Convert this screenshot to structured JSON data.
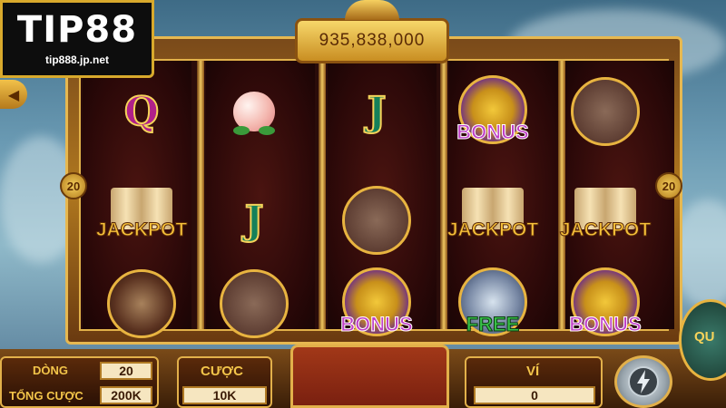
{
  "logo": {
    "brand": "TIP88",
    "url": "tip888.jp.net"
  },
  "balance": "935,838,000",
  "lines_left": "20",
  "lines_right": "20",
  "reels": [
    [
      {
        "type": "letter",
        "text": "Q",
        "kind": "q"
      },
      {
        "type": "jackpot",
        "text": "JACKPOT"
      },
      {
        "type": "icon",
        "icon": "warrior-icon"
      }
    ],
    [
      {
        "type": "icon",
        "icon": "peach-icon"
      },
      {
        "type": "letter",
        "text": "J",
        "kind": "j"
      },
      {
        "type": "icon",
        "icon": "pig-monk-icon"
      }
    ],
    [
      {
        "type": "letter",
        "text": "J",
        "kind": "j"
      },
      {
        "type": "icon",
        "icon": "pig-monk-icon"
      },
      {
        "type": "bonus",
        "text": "BONUS"
      }
    ],
    [
      {
        "type": "bonus",
        "text": "BONUS"
      },
      {
        "type": "jackpot",
        "text": "JACKPOT"
      },
      {
        "type": "free",
        "text": "FREE"
      }
    ],
    [
      {
        "type": "icon",
        "icon": "pig-monk-icon"
      },
      {
        "type": "jackpot",
        "text": "JACKPOT"
      },
      {
        "type": "bonus",
        "text": "BONUS"
      }
    ]
  ],
  "controls": {
    "dong_label": "DÒNG",
    "dong_value": "20",
    "tong_cuoc_label": "TỔNG CƯỢC",
    "tong_cuoc_value": "200K",
    "cuoc_label": "CƯỢC",
    "cuoc_value": "10K",
    "vi_label": "VÍ",
    "vi_value": "0",
    "qc_label": "QU"
  },
  "colors": {
    "gold": "#e2b04a",
    "frame_dark": "#2a0c0a",
    "jackpot": "#f6c13a",
    "bonus": "#c040c8",
    "free": "#38c048"
  }
}
